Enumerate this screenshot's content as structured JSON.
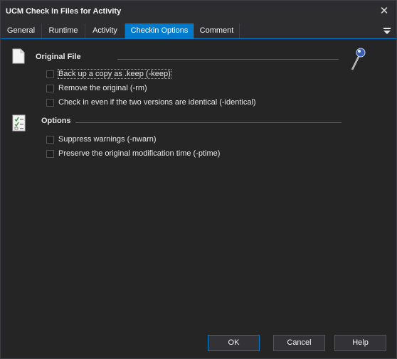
{
  "window": {
    "title": "UCM Check In Files for Activity"
  },
  "tabs": [
    {
      "label": "General",
      "active": false
    },
    {
      "label": "Runtime",
      "active": false
    },
    {
      "label": "Activity",
      "active": false
    },
    {
      "label": "Checkin Options",
      "active": true
    },
    {
      "label": "Comment",
      "active": false
    }
  ],
  "sections": {
    "original_file": {
      "title": "Original File",
      "options": [
        {
          "label": "Back up a copy as .keep (-keep)",
          "checked": false
        },
        {
          "label": "Remove the original (-rm)",
          "checked": false
        },
        {
          "label": "Check in even if the two versions are identical (-identical)",
          "checked": false
        }
      ]
    },
    "options": {
      "title": "Options",
      "options": [
        {
          "label": "Suppress warnings (-nwarn)",
          "checked": false
        },
        {
          "label": "Preserve the original modification time (-ptime)",
          "checked": false
        }
      ]
    }
  },
  "buttons": {
    "ok": "OK",
    "cancel": "Cancel",
    "help": "Help"
  },
  "colors": {
    "accent": "#007acc",
    "background": "#252526",
    "titlebar": "#2d2d30"
  }
}
